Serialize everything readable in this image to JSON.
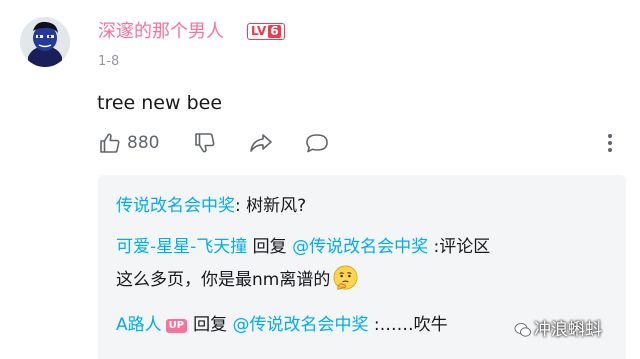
{
  "comment": {
    "user_name": "深邃的那个男人",
    "level_prefix": "LV",
    "level_num": "6",
    "date": "1-8",
    "text": "tree new bee",
    "like_count": "880"
  },
  "replies": {
    "r1_author": "传说改名会中奖",
    "r1_sep": ": ",
    "r1_text": "树新风?",
    "r2_author": "可爱-星星-飞天撞",
    "r2_reply_word": " 回复 ",
    "r2_mention": "@传说改名会中奖",
    "r2_text": " :评论区",
    "r2_text_line2": "这么多页，你是最nm离谱的",
    "r3_author": "A路人",
    "r3_badge": "UP",
    "r3_reply_word": "回复 ",
    "r3_mention": "@传说改名会中奖",
    "r3_text": " :……吹牛"
  },
  "watermark": {
    "text": "冲浪蝌蚪"
  },
  "colors": {
    "name_pink": "#fb7299",
    "link_blue": "#00aeec",
    "level_red": "#ee3b4e",
    "reply_bg": "#f4f5f7"
  }
}
